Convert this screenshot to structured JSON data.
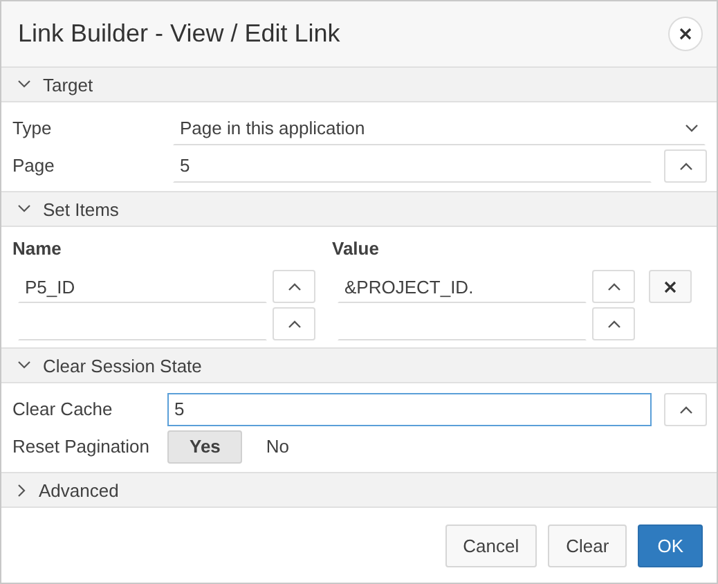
{
  "dialog": {
    "title": "Link Builder - View / Edit Link"
  },
  "sections": [
    {
      "title": "Target",
      "expanded": true,
      "kind": "fields",
      "fields": [
        {
          "label": "Type",
          "kind": "select",
          "value": "Page in this application"
        },
        {
          "label": "Page",
          "kind": "text",
          "value": "5",
          "picker": true,
          "focused": false
        }
      ]
    },
    {
      "title": "Set Items",
      "expanded": true,
      "kind": "items",
      "columns": [
        "Name",
        "Value"
      ],
      "rows": [
        {
          "name": "P5_ID",
          "value": "&PROJECT_ID.",
          "removable": true
        },
        {
          "removable": false
        }
      ]
    },
    {
      "title": "Clear Session State",
      "expanded": true,
      "kind": "fields",
      "fields": [
        {
          "label": "Clear Cache",
          "kind": "text",
          "value": "5",
          "picker": true,
          "focused": true
        },
        {
          "label": "Reset Pagination",
          "kind": "toggle",
          "options": [
            {
              "label": "Yes",
              "selected": true
            },
            {
              "label": "No",
              "selected": false
            }
          ]
        }
      ]
    },
    {
      "title": "Advanced",
      "expanded": false
    }
  ],
  "buttons": [
    {
      "label": "Cancel",
      "kind": "default"
    },
    {
      "label": "Clear",
      "kind": "default"
    },
    {
      "label": "OK",
      "kind": "primary"
    }
  ]
}
